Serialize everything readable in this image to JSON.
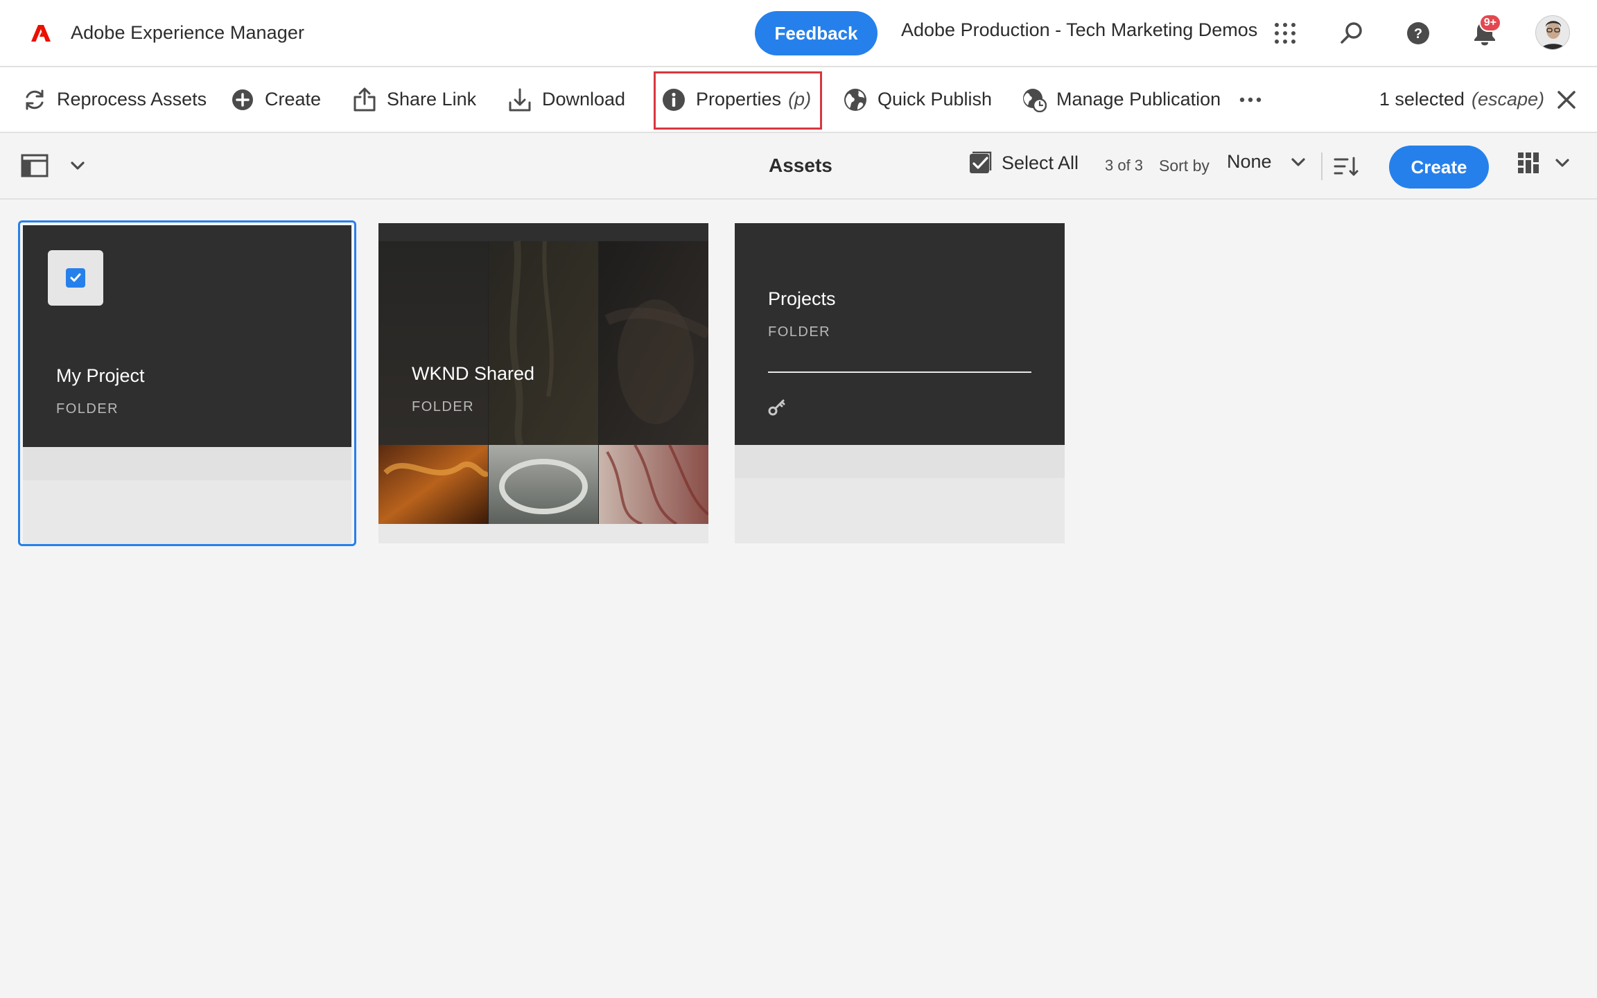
{
  "shell": {
    "product": "Adobe Experience Manager",
    "feedback_label": "Feedback",
    "org": "Adobe Production - Tech Marketing Demos",
    "notifications_badge": "9+",
    "icons": [
      "apps-grid-icon",
      "search-icon",
      "help-icon",
      "bell-icon",
      "avatar"
    ]
  },
  "actionbar": {
    "reprocess": "Reprocess Assets",
    "create": "Create",
    "share_link": "Share Link",
    "download": "Download",
    "properties": "Properties",
    "properties_shortcut": "(p)",
    "quick_publish": "Quick Publish",
    "manage_publication": "Manage Publication",
    "selected_text": "1 selected",
    "escape_hint": "(escape)"
  },
  "subbar": {
    "title": "Assets",
    "select_all": "Select All",
    "count": "3 of 3",
    "sort_by_label": "Sort by",
    "sort_value": "None",
    "create": "Create"
  },
  "cards": [
    {
      "title": "My Project",
      "type": "FOLDER",
      "selected": true
    },
    {
      "title": "WKND Shared",
      "type": "FOLDER",
      "selected": false
    },
    {
      "title": "Projects",
      "type": "FOLDER",
      "selected": false
    }
  ],
  "colors": {
    "accent": "#2680eb",
    "highlight": "#d7373f",
    "adobe_red": "#eb1000",
    "card_dark": "#2f2f2f"
  }
}
